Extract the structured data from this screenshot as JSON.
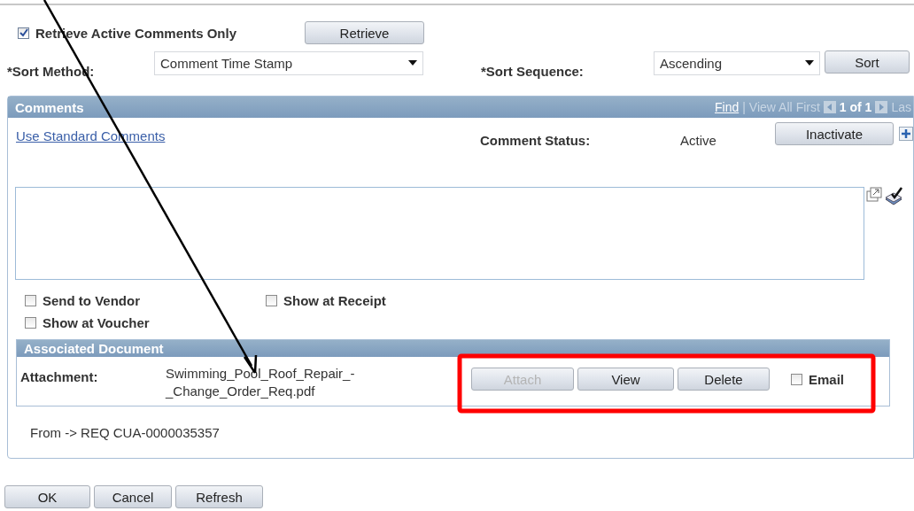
{
  "retrieve_active_only": {
    "label": "Retrieve Active Comments Only",
    "checked": true
  },
  "retrieve_button": "Retrieve",
  "sort_method": {
    "label": "*Sort Method:",
    "value": "Comment Time Stamp"
  },
  "sort_sequence": {
    "label": "*Sort Sequence:",
    "value": "Ascending"
  },
  "sort_button": "Sort",
  "comments": {
    "title": "Comments",
    "nav": {
      "find": "Find",
      "separator": "|",
      "view_all": "View All",
      "first": "First",
      "count": "1 of 1",
      "last": "Las"
    },
    "standard_link": "Use Standard Comments",
    "status_label": "Comment Status:",
    "status_value": "Active",
    "inactivate_button": "Inactivate",
    "options": [
      {
        "label": "Send to Vendor",
        "checked": false
      },
      {
        "label": "Show at Receipt",
        "checked": false
      },
      {
        "label": "Show at Voucher",
        "checked": false
      }
    ],
    "associated_document": {
      "title": "Associated Document",
      "attachment_label": "Attachment:",
      "file_name": "Swimming_Pool_Roof_Repair_-\n_Change_Order_Req.pdf",
      "buttons": [
        {
          "label": "Attach",
          "disabled": true
        },
        {
          "label": "View",
          "disabled": false
        },
        {
          "label": "Delete",
          "disabled": false
        }
      ],
      "email": {
        "label": "Email",
        "checked": false
      }
    },
    "from": "From -> REQ CUA-0000035357"
  },
  "buttons": [
    "OK",
    "Cancel",
    "Refresh"
  ]
}
